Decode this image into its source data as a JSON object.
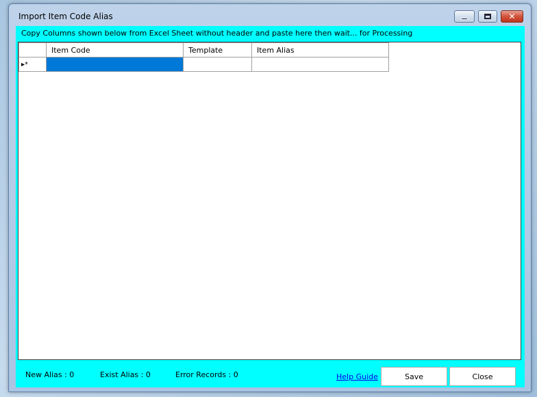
{
  "window": {
    "title": "Import Item Code Alias",
    "controls": {
      "minimize": "",
      "maximize": "",
      "close": "✕"
    }
  },
  "instruction": "Copy Columns shown below from Excel Sheet without header and paste here then wait... for Processing",
  "grid": {
    "columns": [
      "",
      "Item Code",
      "Template",
      "Item Alias"
    ],
    "new_row_marker": "▸*",
    "rows": [
      {
        "item_code": "",
        "template": "",
        "item_alias": ""
      }
    ]
  },
  "status": {
    "new_alias": "New Alias : 0",
    "exist_alias": "Exist Alias : 0",
    "error_records": "Error Records :  0"
  },
  "help_link": "Help Guide",
  "buttons": {
    "save": "Save",
    "close": "Close"
  },
  "colors": {
    "client_bg": "#00ffff",
    "selection": "#0078d7"
  }
}
